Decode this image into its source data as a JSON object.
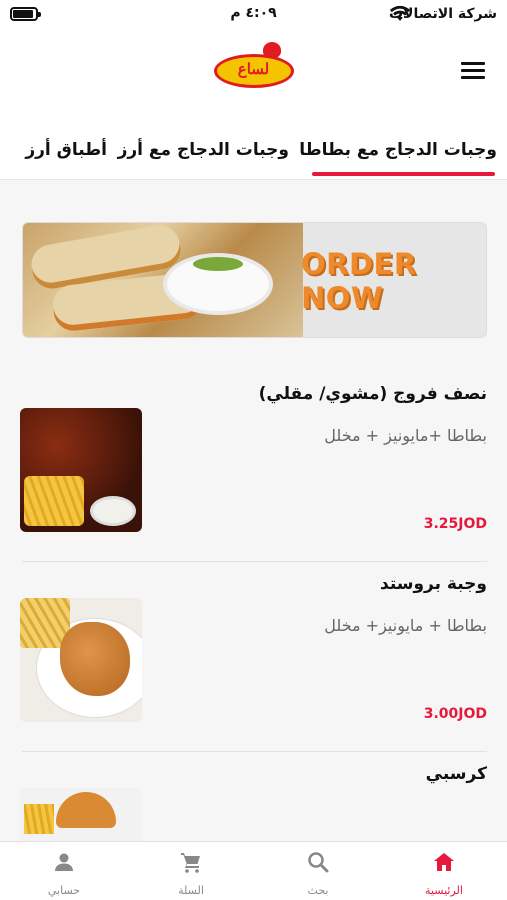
{
  "status_bar": {
    "carrier": "شركة الاتصالات",
    "time": "٤:٠٩ م"
  },
  "header": {
    "logo_text": "لساع"
  },
  "tabs": [
    {
      "label": "وجبات الدجاج مع بطاطا",
      "active": true
    },
    {
      "label": "وجبات الدجاج مع أرز",
      "active": false
    },
    {
      "label": "أطباق أرز",
      "active": false
    }
  ],
  "banner": {
    "text": "ORDER NOW"
  },
  "menu_items": [
    {
      "title": "نصف فروج (مشوي/ مقلي)",
      "description": "بطاطا +مايونيز + مخلل",
      "price": "3.25JOD"
    },
    {
      "title": "وجبة بروستد",
      "description": "بطاطا + مايونيز+ مخلل",
      "price": "3.00JOD"
    },
    {
      "title": "كرسبي",
      "description": "",
      "price": ""
    }
  ],
  "bottom_nav": [
    {
      "label": "الرئيسية",
      "icon": "home-icon",
      "active": true
    },
    {
      "label": "بحث",
      "icon": "search-icon",
      "active": false
    },
    {
      "label": "السلة",
      "icon": "cart-icon",
      "active": false
    },
    {
      "label": "حسابي",
      "icon": "user-icon",
      "active": false
    }
  ],
  "colors": {
    "accent": "#e5193b",
    "banner_text": "#ee8a2c"
  }
}
